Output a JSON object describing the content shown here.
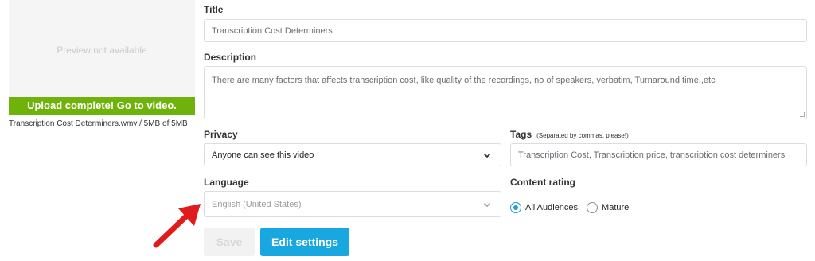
{
  "preview": {
    "placeholder": "Preview not available",
    "upload_status": "Upload complete! Go to video.",
    "file_info": "Transcription Cost Determiners.wmv / 5MB of 5MB"
  },
  "form": {
    "title_label": "Title",
    "title_value": "Transcription Cost Determiners",
    "description_label": "Description",
    "description_value": "There are many factors that affects transcription cost, like quality of the recordings, no of speakers, verbatim, Turnaround time.,etc",
    "privacy_label": "Privacy",
    "privacy_value": "Anyone can see this video",
    "tags_label": "Tags",
    "tags_hint": "(Separated by commas, please!)",
    "tags_value": "Transcription Cost, Transcription price, transcription cost determiners",
    "language_label": "Language",
    "language_value": "English (United States)",
    "content_rating_label": "Content rating",
    "rating_options": [
      "All Audiences",
      "Mature"
    ],
    "rating_selected": "All Audiences"
  },
  "buttons": {
    "save_label": "Save",
    "edit_settings_label": "Edit settings"
  },
  "colors": {
    "upload_bar": "#6fb30a",
    "primary_button": "#19a7e0",
    "radio_selected": "#1a9fd6",
    "annotation_arrow": "#e01b1b"
  },
  "icons": {
    "select_chevron": "chevron-down-icon",
    "annotation": "red-arrow-icon"
  }
}
